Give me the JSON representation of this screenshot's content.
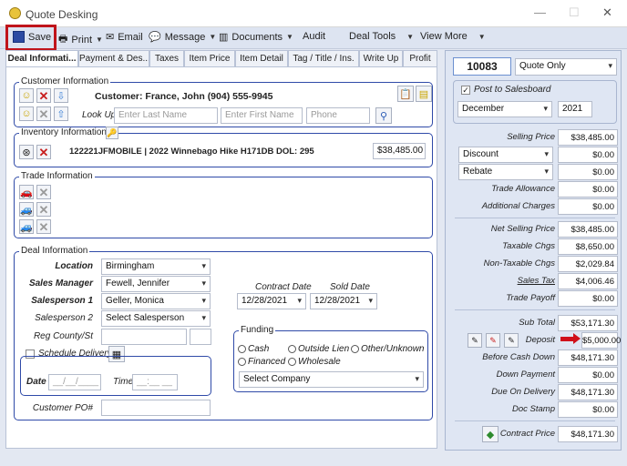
{
  "window": {
    "title": "Quote Desking"
  },
  "toolbar": {
    "save": "Save",
    "print": "Print",
    "email": "Email",
    "message": "Message",
    "documents": "Documents",
    "audit": "Audit",
    "deal_tools": "Deal Tools",
    "view_more": "View More"
  },
  "tabs": [
    "Deal Informati...",
    "Payment & Des...",
    "Taxes",
    "Item Price",
    "Item Detail",
    "Tag / Title / Ins.",
    "Write Up",
    "Profit"
  ],
  "customer": {
    "legend": "Customer Information",
    "name": "Customer: France, John  (904) 555-9945",
    "lookup_label": "Look Up:",
    "last_name_placeholder": "Enter Last Name",
    "first_name_placeholder": "Enter First Name",
    "phone_placeholder": "Phone"
  },
  "inventory": {
    "legend": "Inventory Information -",
    "vehicle": "122221JFMOBILE |  2022 Winnebago Hike H171DB DOL: 295",
    "price": "$38,485.00"
  },
  "trade": {
    "legend": "Trade Information"
  },
  "deal": {
    "legend": "Deal Information",
    "location_label": "Location",
    "location": "Birmingham",
    "sales_manager_label": "Sales Manager",
    "sales_manager": "Fewell, Jennifer",
    "salesperson1_label": "Salesperson 1",
    "salesperson1": "Geller, Monica",
    "salesperson2_label": "Salesperson 2",
    "salesperson2": "Select Salesperson",
    "reg_label": "Reg County/St",
    "schedule_delivery": "Schedule Delivery",
    "date_label": "Date",
    "date_placeholder": "__/__/____",
    "time_label": "Time",
    "time_placeholder": "__:__ __",
    "customer_po_label": "Customer PO#",
    "contract_date_label": "Contract Date",
    "contract_date": "12/28/2021",
    "sold_date_label": "Sold Date",
    "sold_date": "12/28/2021",
    "funding_legend": "Funding",
    "funding_options": [
      "Cash",
      "Outside Lien",
      "Other/Unknown",
      "Financed",
      "Wholesale"
    ],
    "select_company": "Select Company"
  },
  "right": {
    "quote_number": "10083",
    "quote_type": "Quote Only",
    "post_to_salesboard": "Post to Salesboard",
    "month": "December",
    "year": "2021",
    "selling_price_label": "Selling Price",
    "selling_price": "$38,485.00",
    "discount_label": "Discount",
    "discount": "$0.00",
    "rebate_label": "Rebate",
    "rebate": "$0.00",
    "trade_allowance_label": "Trade Allowance",
    "trade_allowance": "$0.00",
    "additional_charges_label": "Additional Charges",
    "additional_charges": "$0.00",
    "net_selling_price_label": "Net Selling Price",
    "net_selling_price": "$38,485.00",
    "taxable_chgs_label": "Taxable Chgs",
    "taxable_chgs": "$8,650.00",
    "non_taxable_chgs_label": "Non-Taxable Chgs",
    "non_taxable_chgs": "$2,029.84",
    "sales_tax_label": "Sales Tax",
    "sales_tax": "$4,006.46",
    "trade_payoff_label": "Trade Payoff",
    "trade_payoff": "$0.00",
    "sub_total_label": "Sub Total",
    "sub_total": "$53,171.30",
    "deposit_label": "Deposit",
    "deposit": "$5,000.00",
    "before_cash_down_label": "Before Cash Down",
    "before_cash_down": "$48,171.30",
    "down_payment_label": "Down Payment",
    "down_payment": "$0.00",
    "due_on_delivery_label": "Due On Delivery",
    "due_on_delivery": "$48,171.30",
    "doc_stamp_label": "Doc Stamp",
    "doc_stamp": "$0.00",
    "contract_price_label": "Contract Price",
    "contract_price": "$48,171.30"
  },
  "colors": {
    "highlight_red": "#c0141b",
    "group_border": "#2f4aa8",
    "toolbar_bg": "#dde4f1"
  }
}
